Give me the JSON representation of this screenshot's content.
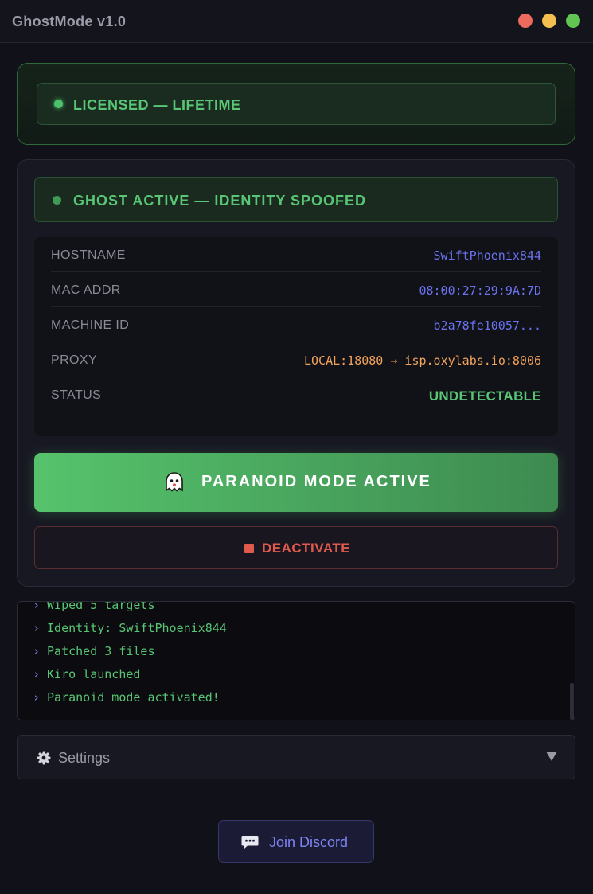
{
  "window": {
    "title": "GhostMode v1.0",
    "controls": [
      "close",
      "minimize",
      "maximize"
    ]
  },
  "license": {
    "text": "LICENSED — LIFETIME",
    "color": "#58c674"
  },
  "status": {
    "text": "GHOST ACTIVE — IDENTITY SPOOFED"
  },
  "info": [
    {
      "label": "HOSTNAME",
      "value": "SwiftPhoenix844"
    },
    {
      "label": "MAC ADDR",
      "value": "08:00:27:29:9A:7D"
    },
    {
      "label": "MACHINE ID",
      "value": "b2a78fe10057..."
    },
    {
      "label": "PROXY",
      "value": "LOCAL:18080 → isp.oxylabs.io:8006"
    },
    {
      "label": "STATUS",
      "value": "UNDETECTABLE"
    }
  ],
  "paranoid_button": {
    "icon": "ghost-icon",
    "label": "PARANOID MODE ACTIVE"
  },
  "deactivate_button": {
    "icon": "stop-icon",
    "label": "DEACTIVATE"
  },
  "log": {
    "prompt": "›",
    "lines": [
      "Wiped 5 targets",
      "Identity: SwiftPhoenix844",
      "Patched 3 files",
      "Kiro launched",
      "Paranoid mode activated!"
    ]
  },
  "settings": {
    "icon": "gear-icon",
    "label": "Settings",
    "expanded": false
  },
  "discord": {
    "icon": "chat-icon",
    "label": "Join Discord"
  },
  "colors": {
    "accent_green": "#58c674",
    "accent_blue": "#6a73ee",
    "proxy_orange": "#f2a45c",
    "danger_red": "#e05a4e"
  }
}
